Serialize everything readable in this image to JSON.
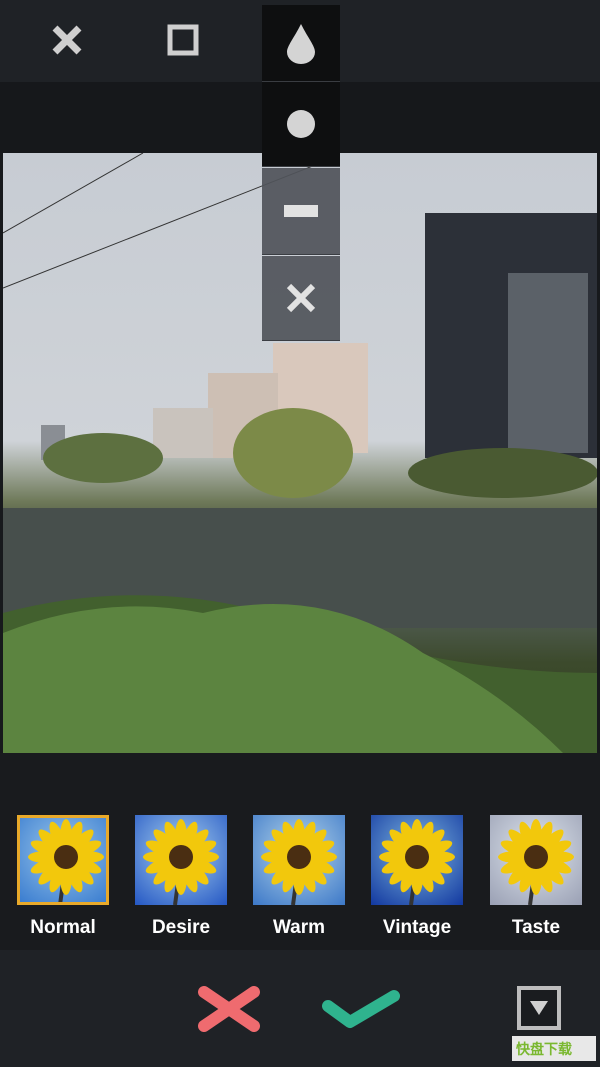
{
  "toolbar": {
    "icons": [
      "close-icon",
      "square-frame-icon",
      "drop-icon"
    ]
  },
  "shape_menu": {
    "items": [
      "drop-icon",
      "circle-icon",
      "minus-icon",
      "close-icon"
    ]
  },
  "filters": [
    {
      "label": "Normal",
      "selected": true
    },
    {
      "label": "Desire",
      "selected": false
    },
    {
      "label": "Warm",
      "selected": false
    },
    {
      "label": "Vintage",
      "selected": false
    },
    {
      "label": "Taste",
      "selected": false
    }
  ],
  "actions": {
    "cancel_icon": "cross-icon",
    "confirm_icon": "check-icon",
    "more_icon": "dropdown-arrow-icon"
  },
  "colors": {
    "selected_border": "#e8a92a",
    "cancel": "#ef6b6f",
    "confirm": "#2fb38e"
  },
  "watermark": {
    "text": "快盘下载"
  }
}
